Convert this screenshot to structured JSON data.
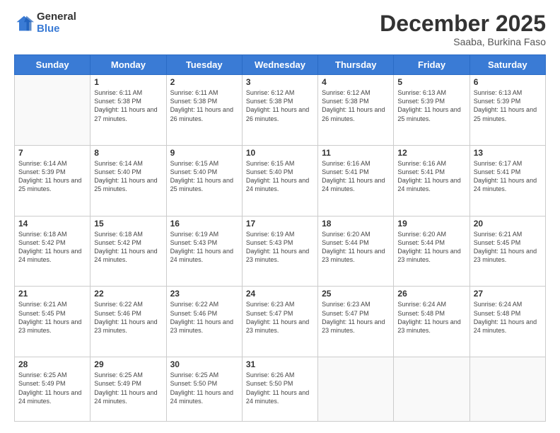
{
  "header": {
    "logo_general": "General",
    "logo_blue": "Blue",
    "month_title": "December 2025",
    "subtitle": "Saaba, Burkina Faso"
  },
  "days_of_week": [
    "Sunday",
    "Monday",
    "Tuesday",
    "Wednesday",
    "Thursday",
    "Friday",
    "Saturday"
  ],
  "weeks": [
    [
      {
        "day": "",
        "sunrise": "",
        "sunset": "",
        "daylight": ""
      },
      {
        "day": "1",
        "sunrise": "Sunrise: 6:11 AM",
        "sunset": "Sunset: 5:38 PM",
        "daylight": "Daylight: 11 hours and 27 minutes."
      },
      {
        "day": "2",
        "sunrise": "Sunrise: 6:11 AM",
        "sunset": "Sunset: 5:38 PM",
        "daylight": "Daylight: 11 hours and 26 minutes."
      },
      {
        "day": "3",
        "sunrise": "Sunrise: 6:12 AM",
        "sunset": "Sunset: 5:38 PM",
        "daylight": "Daylight: 11 hours and 26 minutes."
      },
      {
        "day": "4",
        "sunrise": "Sunrise: 6:12 AM",
        "sunset": "Sunset: 5:38 PM",
        "daylight": "Daylight: 11 hours and 26 minutes."
      },
      {
        "day": "5",
        "sunrise": "Sunrise: 6:13 AM",
        "sunset": "Sunset: 5:39 PM",
        "daylight": "Daylight: 11 hours and 25 minutes."
      },
      {
        "day": "6",
        "sunrise": "Sunrise: 6:13 AM",
        "sunset": "Sunset: 5:39 PM",
        "daylight": "Daylight: 11 hours and 25 minutes."
      }
    ],
    [
      {
        "day": "7",
        "sunrise": "Sunrise: 6:14 AM",
        "sunset": "Sunset: 5:39 PM",
        "daylight": "Daylight: 11 hours and 25 minutes."
      },
      {
        "day": "8",
        "sunrise": "Sunrise: 6:14 AM",
        "sunset": "Sunset: 5:40 PM",
        "daylight": "Daylight: 11 hours and 25 minutes."
      },
      {
        "day": "9",
        "sunrise": "Sunrise: 6:15 AM",
        "sunset": "Sunset: 5:40 PM",
        "daylight": "Daylight: 11 hours and 25 minutes."
      },
      {
        "day": "10",
        "sunrise": "Sunrise: 6:15 AM",
        "sunset": "Sunset: 5:40 PM",
        "daylight": "Daylight: 11 hours and 24 minutes."
      },
      {
        "day": "11",
        "sunrise": "Sunrise: 6:16 AM",
        "sunset": "Sunset: 5:41 PM",
        "daylight": "Daylight: 11 hours and 24 minutes."
      },
      {
        "day": "12",
        "sunrise": "Sunrise: 6:16 AM",
        "sunset": "Sunset: 5:41 PM",
        "daylight": "Daylight: 11 hours and 24 minutes."
      },
      {
        "day": "13",
        "sunrise": "Sunrise: 6:17 AM",
        "sunset": "Sunset: 5:41 PM",
        "daylight": "Daylight: 11 hours and 24 minutes."
      }
    ],
    [
      {
        "day": "14",
        "sunrise": "Sunrise: 6:18 AM",
        "sunset": "Sunset: 5:42 PM",
        "daylight": "Daylight: 11 hours and 24 minutes."
      },
      {
        "day": "15",
        "sunrise": "Sunrise: 6:18 AM",
        "sunset": "Sunset: 5:42 PM",
        "daylight": "Daylight: 11 hours and 24 minutes."
      },
      {
        "day": "16",
        "sunrise": "Sunrise: 6:19 AM",
        "sunset": "Sunset: 5:43 PM",
        "daylight": "Daylight: 11 hours and 24 minutes."
      },
      {
        "day": "17",
        "sunrise": "Sunrise: 6:19 AM",
        "sunset": "Sunset: 5:43 PM",
        "daylight": "Daylight: 11 hours and 23 minutes."
      },
      {
        "day": "18",
        "sunrise": "Sunrise: 6:20 AM",
        "sunset": "Sunset: 5:44 PM",
        "daylight": "Daylight: 11 hours and 23 minutes."
      },
      {
        "day": "19",
        "sunrise": "Sunrise: 6:20 AM",
        "sunset": "Sunset: 5:44 PM",
        "daylight": "Daylight: 11 hours and 23 minutes."
      },
      {
        "day": "20",
        "sunrise": "Sunrise: 6:21 AM",
        "sunset": "Sunset: 5:45 PM",
        "daylight": "Daylight: 11 hours and 23 minutes."
      }
    ],
    [
      {
        "day": "21",
        "sunrise": "Sunrise: 6:21 AM",
        "sunset": "Sunset: 5:45 PM",
        "daylight": "Daylight: 11 hours and 23 minutes."
      },
      {
        "day": "22",
        "sunrise": "Sunrise: 6:22 AM",
        "sunset": "Sunset: 5:46 PM",
        "daylight": "Daylight: 11 hours and 23 minutes."
      },
      {
        "day": "23",
        "sunrise": "Sunrise: 6:22 AM",
        "sunset": "Sunset: 5:46 PM",
        "daylight": "Daylight: 11 hours and 23 minutes."
      },
      {
        "day": "24",
        "sunrise": "Sunrise: 6:23 AM",
        "sunset": "Sunset: 5:47 PM",
        "daylight": "Daylight: 11 hours and 23 minutes."
      },
      {
        "day": "25",
        "sunrise": "Sunrise: 6:23 AM",
        "sunset": "Sunset: 5:47 PM",
        "daylight": "Daylight: 11 hours and 23 minutes."
      },
      {
        "day": "26",
        "sunrise": "Sunrise: 6:24 AM",
        "sunset": "Sunset: 5:48 PM",
        "daylight": "Daylight: 11 hours and 23 minutes."
      },
      {
        "day": "27",
        "sunrise": "Sunrise: 6:24 AM",
        "sunset": "Sunset: 5:48 PM",
        "daylight": "Daylight: 11 hours and 24 minutes."
      }
    ],
    [
      {
        "day": "28",
        "sunrise": "Sunrise: 6:25 AM",
        "sunset": "Sunset: 5:49 PM",
        "daylight": "Daylight: 11 hours and 24 minutes."
      },
      {
        "day": "29",
        "sunrise": "Sunrise: 6:25 AM",
        "sunset": "Sunset: 5:49 PM",
        "daylight": "Daylight: 11 hours and 24 minutes."
      },
      {
        "day": "30",
        "sunrise": "Sunrise: 6:25 AM",
        "sunset": "Sunset: 5:50 PM",
        "daylight": "Daylight: 11 hours and 24 minutes."
      },
      {
        "day": "31",
        "sunrise": "Sunrise: 6:26 AM",
        "sunset": "Sunset: 5:50 PM",
        "daylight": "Daylight: 11 hours and 24 minutes."
      },
      {
        "day": "",
        "sunrise": "",
        "sunset": "",
        "daylight": ""
      },
      {
        "day": "",
        "sunrise": "",
        "sunset": "",
        "daylight": ""
      },
      {
        "day": "",
        "sunrise": "",
        "sunset": "",
        "daylight": ""
      }
    ]
  ]
}
